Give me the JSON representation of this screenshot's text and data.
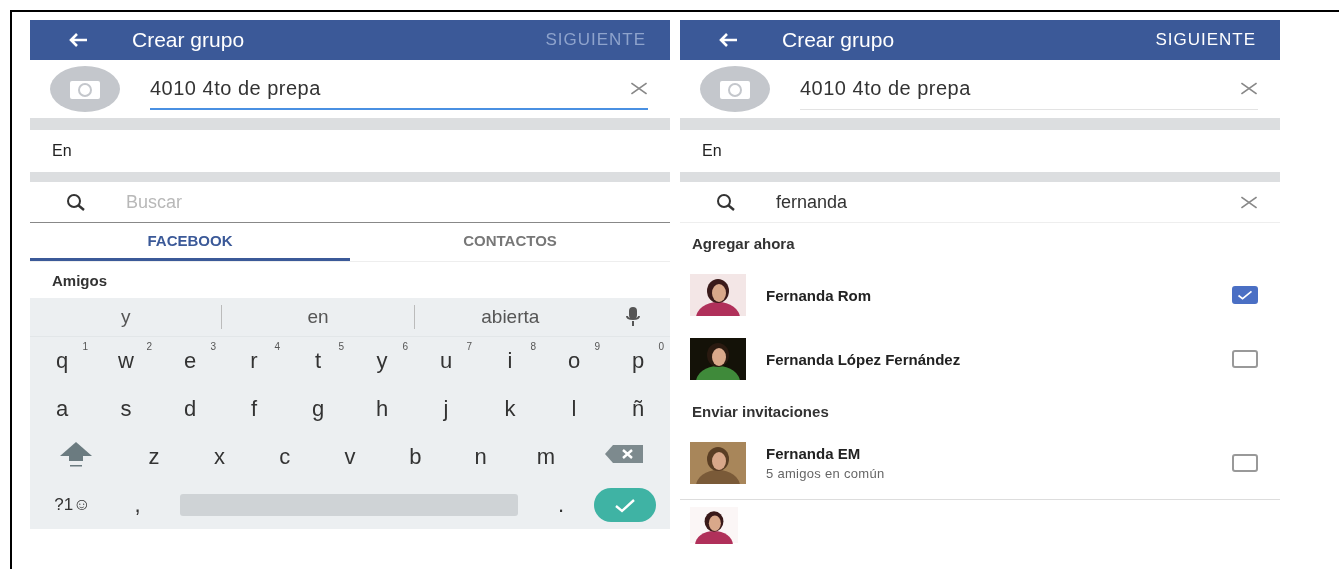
{
  "screens": [
    {
      "kind": "compose",
      "header": {
        "title": "Crear grupo",
        "action": "SIGUIENTE",
        "action_enabled": false
      },
      "name_field": {
        "value": "4010 4to de prepa",
        "focused": true
      },
      "privacy_label": "En",
      "search": {
        "placeholder": "Buscar"
      },
      "tabs": [
        {
          "label": "FACEBOOK",
          "selected": true
        },
        {
          "label": "CONTACTOS",
          "selected": false
        }
      ],
      "section": "Amigos",
      "keyboard": {
        "suggestions": [
          "y",
          "en",
          "abierta"
        ],
        "rows": [
          [
            {
              "kind": "char",
              "key": "q",
              "hint": "1"
            },
            {
              "kind": "char",
              "key": "w",
              "hint": "2"
            },
            {
              "kind": "char",
              "key": "e",
              "hint": "3"
            },
            {
              "kind": "char",
              "key": "r",
              "hint": "4"
            },
            {
              "kind": "char",
              "key": "t",
              "hint": "5"
            },
            {
              "kind": "char",
              "key": "y",
              "hint": "6"
            },
            {
              "kind": "char",
              "key": "u",
              "hint": "7"
            },
            {
              "kind": "char",
              "key": "i",
              "hint": "8"
            },
            {
              "kind": "char",
              "key": "o",
              "hint": "9"
            },
            {
              "kind": "char",
              "key": "p",
              "hint": "0"
            }
          ],
          [
            {
              "kind": "char",
              "key": "a"
            },
            {
              "kind": "char",
              "key": "s"
            },
            {
              "kind": "char",
              "key": "d"
            },
            {
              "kind": "char",
              "key": "f"
            },
            {
              "kind": "char",
              "key": "g"
            },
            {
              "kind": "char",
              "key": "h"
            },
            {
              "kind": "char",
              "key": "j"
            },
            {
              "kind": "char",
              "key": "k"
            },
            {
              "kind": "char",
              "key": "l"
            },
            {
              "kind": "char",
              "key": "ñ"
            }
          ],
          [
            {
              "kind": "shift"
            },
            {
              "kind": "char",
              "key": "z"
            },
            {
              "kind": "char",
              "key": "x"
            },
            {
              "kind": "char",
              "key": "c"
            },
            {
              "kind": "char",
              "key": "v"
            },
            {
              "kind": "char",
              "key": "b"
            },
            {
              "kind": "char",
              "key": "n"
            },
            {
              "kind": "char",
              "key": "m"
            },
            {
              "kind": "backspace"
            }
          ],
          [
            {
              "kind": "char",
              "key": "?1☺"
            },
            {
              "kind": "char",
              "key": ","
            },
            {
              "kind": "space"
            },
            {
              "kind": "char",
              "key": "."
            },
            {
              "kind": "enter"
            }
          ]
        ]
      }
    },
    {
      "kind": "results",
      "header": {
        "title": "Crear grupo",
        "action": "SIGUIENTE",
        "action_enabled": true
      },
      "name_field": {
        "value": "4010 4to de prepa",
        "focused": false
      },
      "privacy_label": "En",
      "search": {
        "value": "fernanda"
      },
      "sections": [
        {
          "title": "Agregar ahora",
          "people": [
            {
              "name": "Fernanda Rom",
              "checked": true
            },
            {
              "name": "Fernanda López Fernández",
              "checked": false
            }
          ]
        },
        {
          "title": "Enviar invitaciones",
          "people": [
            {
              "name": "Fernanda EM",
              "subtitle": "5 amigos en común",
              "checked": false
            }
          ]
        }
      ]
    }
  ]
}
